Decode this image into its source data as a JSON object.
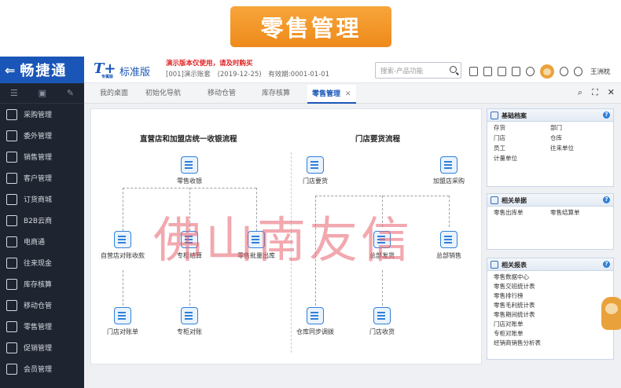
{
  "banner": {
    "title": "零售管理"
  },
  "sidebar": {
    "logo": "畅捷通",
    "items": [
      {
        "label": "采购管理",
        "icon": "cart-icon"
      },
      {
        "label": "委外管理",
        "icon": "outsource-icon"
      },
      {
        "label": "销售管理",
        "icon": "sales-icon"
      },
      {
        "label": "客户管理",
        "icon": "customer-icon"
      },
      {
        "label": "订货商城",
        "icon": "mall-icon"
      },
      {
        "label": "B2B云商",
        "icon": "b2b-icon"
      },
      {
        "label": "电商通",
        "icon": "ecommerce-icon"
      },
      {
        "label": "往来现金",
        "icon": "cash-icon"
      },
      {
        "label": "库存核算",
        "icon": "inventory-icon"
      },
      {
        "label": "移动仓管",
        "icon": "mobile-warehouse-icon"
      },
      {
        "label": "零售管理",
        "icon": "retail-icon"
      },
      {
        "label": "促销管理",
        "icon": "promotion-icon"
      },
      {
        "label": "会员管理",
        "icon": "member-icon"
      }
    ]
  },
  "header": {
    "brand_logo": "T+",
    "brand_logo_sub": "专属版",
    "brand_name": "标准版",
    "demo_note": "演示版本仅使用，请及时购买",
    "account": "[001]演示账套",
    "date": "(2019-12-25)",
    "valid": "有效期:0001-01-01",
    "search_placeholder": "搜索-产品功能",
    "user": "王洲枕"
  },
  "tabs": [
    {
      "label": "我的桌面"
    },
    {
      "label": "初始化导航"
    },
    {
      "label": "移动仓管"
    },
    {
      "label": "库存核算"
    },
    {
      "label": "零售管理",
      "active": true
    }
  ],
  "flow": {
    "left_title": "直营店和加盟店统一收银流程",
    "right_title": "门店要货流程",
    "nodes": {
      "retail_checkout": "零售收银",
      "direct_reconcile": "自营店对账收款",
      "counter_settle": "专柜结算",
      "retail_wholesale": "零售批量出库",
      "store_statement": "门店对账单",
      "counter_reconcile": "专柜对账",
      "store_request": "门店要货",
      "franchise_purchase": "加盟店采购",
      "hq_ship": "总部发货",
      "hq_sales": "总部销售",
      "warehouse_transfer": "仓库同步调拨",
      "store_receive": "门店收货"
    }
  },
  "panels": {
    "basic": {
      "title": "基础档案",
      "items": [
        "存货",
        "部门",
        "门店",
        "仓库",
        "员工",
        "往来单位",
        "计量单位",
        ""
      ]
    },
    "docs": {
      "title": "相关单据",
      "items": [
        "零售出库单",
        "零售结算单"
      ]
    },
    "reports": {
      "title": "相关报表",
      "items": [
        "零售数据中心",
        "零售交班统计表",
        "零售排行榜",
        "零售毛利统计表",
        "零售期间统计表",
        "门店对账单",
        "专柜对账单",
        "经销商销售分析表"
      ]
    }
  },
  "watermark": "佛山南友信",
  "colors": {
    "brand": "#1a56b8",
    "banner": "#ee8a1b",
    "sidebar": "#1e2430"
  }
}
